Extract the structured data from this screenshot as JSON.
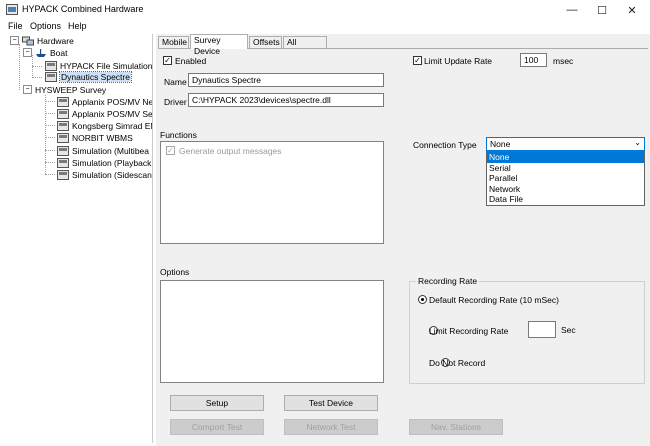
{
  "window": {
    "title": "HYPACK Combined Hardware",
    "minimize": "—",
    "maximize": "☐",
    "close": "✕"
  },
  "menu": [
    "File",
    "Options",
    "Help"
  ],
  "tree": {
    "root": "Hardware",
    "boat": "Boat",
    "boat_items": [
      "HYPACK File Simulation",
      "Dynautics Spectre"
    ],
    "hysweep": "HYSWEEP Survey",
    "hysweep_items": [
      "Applanix POS/MV Ne",
      "Applanix POS/MV Ser",
      "Kongsberg Simrad EM",
      "NORBIT WBMS",
      "Simulation (Multibea",
      "Simulation (Playback",
      "Simulation (Sidescan)"
    ],
    "selected": "Dynautics Spectre"
  },
  "tabs": [
    "Mobile",
    "Survey Device",
    "Offsets",
    "All Offsets"
  ],
  "active_tab": "Survey Device",
  "device": {
    "enabled_label": "Enabled",
    "enabled_checked": true,
    "name_label": "Name",
    "name_value": "Dynautics Spectre",
    "driver_label": "Driver",
    "driver_value": "C:\\HYPACK 2023\\devices\\spectre.dll",
    "limit_rate_label": "Limit Update Rate",
    "limit_rate_checked": true,
    "limit_rate_value": "100",
    "limit_rate_unit": "msec"
  },
  "functions": {
    "label": "Functions",
    "items": [
      {
        "label": "Generate output messages",
        "checked": true,
        "disabled": true
      }
    ]
  },
  "connection": {
    "label": "Connection Type",
    "selected": "None",
    "options": [
      "None",
      "Serial",
      "Parallel",
      "Network",
      "Data File"
    ]
  },
  "options": {
    "label": "Options"
  },
  "recording": {
    "label": "Recording Rate",
    "default_label": "Default Recording Rate (10 mSec)",
    "limit_label": "Limit Recording Rate",
    "limit_unit": "Sec",
    "none_label": "Do Not Record",
    "selected": "default"
  },
  "buttons": {
    "setup": "Setup",
    "test_device": "Test Device",
    "comport_test": "Comport Test",
    "network_test": "Network Test",
    "nav_stations": "Nav. Stations"
  },
  "colors": {
    "accent": "#0078d7",
    "selection": "#cce0f5",
    "panel_bg": "#f0f0f0"
  }
}
